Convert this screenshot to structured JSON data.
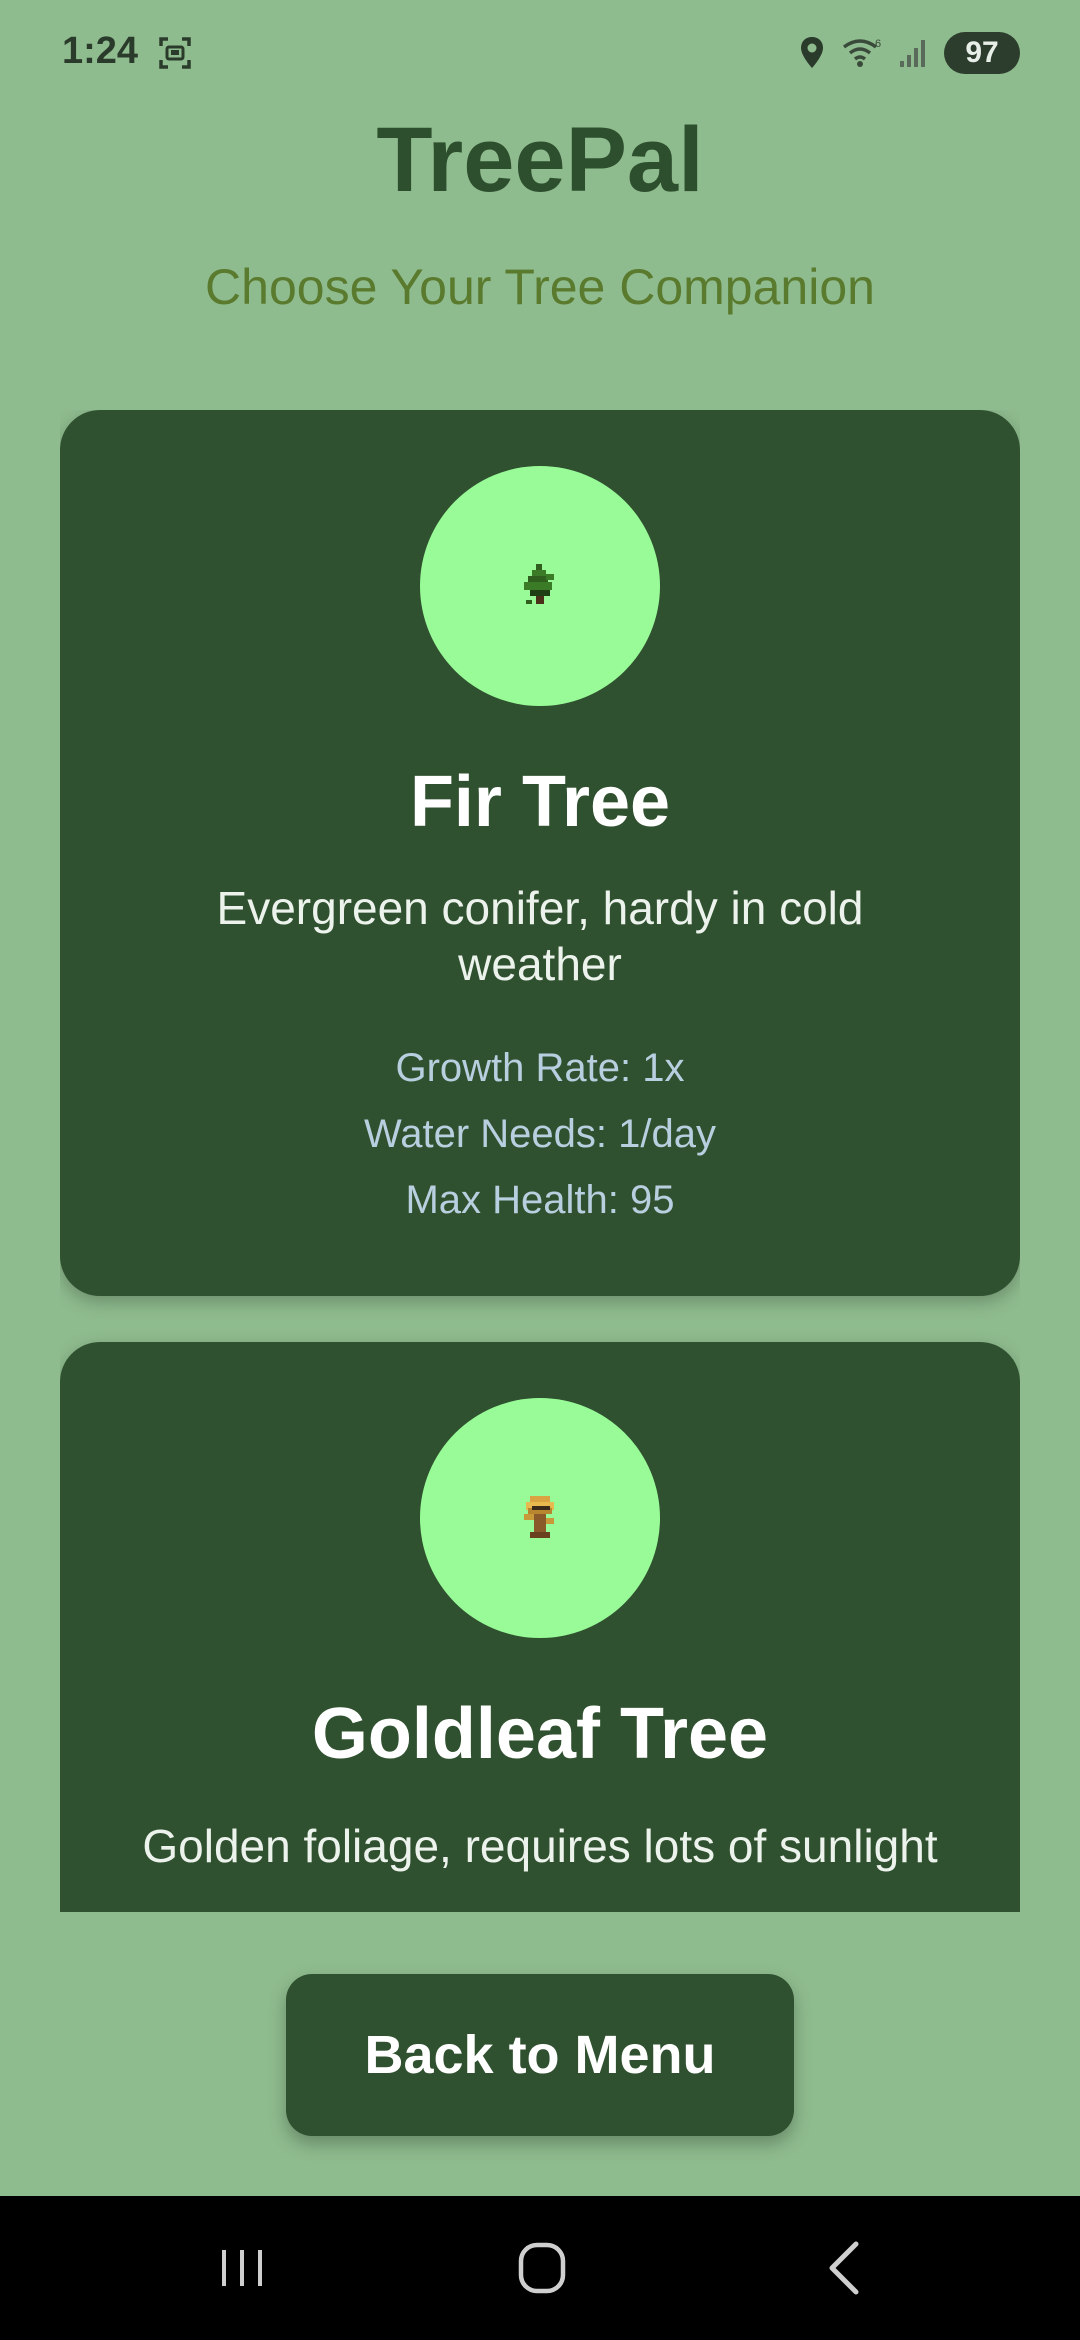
{
  "status_bar": {
    "time": "1:24",
    "battery": "97",
    "icons": [
      "screenshot-icon",
      "location-icon",
      "wifi-icon",
      "signal-icon"
    ]
  },
  "app": {
    "title": "TreePal",
    "subtitle": "Choose Your Tree Companion"
  },
  "trees": [
    {
      "name": "Fir Tree",
      "description": "Evergreen conifer, hardy in cold weather",
      "growth_rate": "Growth Rate: 1x",
      "water_needs": "Water Needs: 1/day",
      "max_health": "Max Health: 95",
      "icon": "fir-tree-sprite-icon"
    },
    {
      "name": "Goldleaf Tree",
      "description": "Golden foliage, requires lots of sunlight",
      "icon": "goldleaf-tree-sprite-icon"
    }
  ],
  "back_button": {
    "label": "Back to Menu"
  },
  "nav_bar": {
    "icons": [
      "recents-icon",
      "home-icon",
      "back-icon"
    ]
  },
  "colors": {
    "background": "#8fbc8f",
    "card": "#30512f",
    "avatar": "#98fb98",
    "title": "#2e4f2e",
    "subtitle": "#5a7a2e",
    "stat_text": "#b8cfe0"
  }
}
